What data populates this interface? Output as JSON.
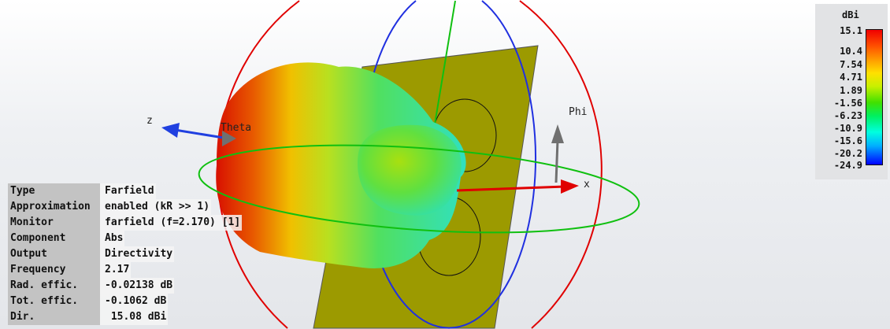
{
  "axes": {
    "z": "z",
    "x": "x",
    "theta": "Theta",
    "phi": "Phi"
  },
  "info": [
    {
      "label": "Type",
      "value": "Farfield"
    },
    {
      "label": "Approximation",
      "value": "enabled (kR >> 1)"
    },
    {
      "label": "Monitor",
      "value": "farfield (f=2.170) [1]"
    },
    {
      "label": "Component",
      "value": "Abs"
    },
    {
      "label": "Output",
      "value": "Directivity"
    },
    {
      "label": "Frequency",
      "value": "2.17"
    },
    {
      "label": "Rad. effic.",
      "value": "-0.02138 dB"
    },
    {
      "label": "Tot. effic.",
      "value": "-0.1062 dB"
    },
    {
      "label": "Dir.",
      "value": " 15.08 dBi"
    }
  ],
  "legend": {
    "unit": "dBi",
    "ticks": [
      "15.1",
      "10.4",
      "7.54",
      "4.71",
      "1.89",
      "-1.56",
      "-6.23",
      "-10.9",
      "-15.6",
      "-20.2",
      "-24.9"
    ]
  }
}
